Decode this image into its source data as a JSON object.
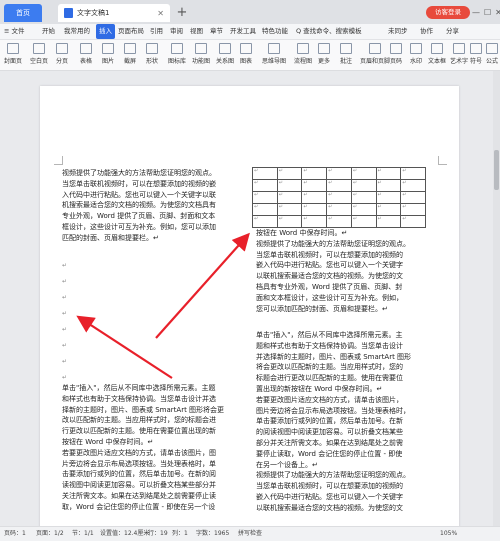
{
  "titlebar": {
    "home_tab": "首页",
    "doc_tab": "文字文稿1",
    "new_tab": "+",
    "login": "访客登录",
    "window_controls": [
      "—",
      "☐",
      "✕"
    ]
  },
  "menubar": {
    "items": [
      "≡ 文件",
      "开始",
      "插入",
      "页面布局",
      "引用",
      "审阅",
      "视图",
      "章节",
      "开发工具",
      "特色功能",
      "Q 查找命令、搜索模板"
    ],
    "active": "插入",
    "right": [
      "未同步",
      "协作",
      "分享"
    ]
  },
  "ribbon": {
    "items": [
      "封面页",
      "空白页",
      "分页",
      "表格",
      "图片",
      "截屏",
      "形状",
      "图标库",
      "功能图",
      "关系图",
      "图表",
      "思维导图",
      "流程图",
      "更多",
      "批注",
      "页眉和页脚",
      "页码",
      "水印",
      "文本框",
      "艺术字",
      "符号",
      "公式"
    ]
  },
  "document": {
    "left_col": [
      "视频提供了功能强大的方法帮助您证明您的观点。",
      "当您单击联机视频时，可以在想要添加的视频的嵌",
      "入代码中进行粘贴。您也可以键入一个关键字以联",
      "机搜索最适合您的文档的视频。为使您的文档具有",
      "专业外观，Word 提供了页眉、页脚、封面和文本",
      "框设计，这些设计可互为补充。例如，您可以添加",
      "匹配的封面、页眉和提要栏。↵"
    ],
    "left_col_bottom": [
      "单击\"插入\"，然后从不同库中选择所需元素。主题",
      "和样式也有助于文档保持协调。当您单击设计并选",
      "择新的主题时，图片、图表或 SmartArt 图形将会更",
      "改以匹配新的主题。当应用样式时，您的标题会进",
      "行更改以匹配新的主题。使用在需要位置出现的新",
      "按钮在 Word 中保存时间。↵",
      "若要更改图片适应文档的方式，请单击该图片，图",
      "片旁边将会显示布局选项按钮。当处理表格时，单",
      "击要添加行或列的位置，然后单击加号。在新的阅",
      "读视图中阅读更加容易。可以折叠文档某些部分并",
      "关注所需文本。如果在达到结尾处之前需要停止读",
      "取，Word 会记住您的停止位置 - 即使在另一个设"
    ],
    "right_col_top": [
      "按钮在 Word 中保存时间。↵",
      "视频提供了功能强大的方法帮助您证明您的观点。",
      "当您单击联机视频时，可以在想要添加的视频的",
      "嵌入代码中进行粘贴。您也可以键入一个关键字",
      "以联机搜索最适合您的文档的视频。为使您的文",
      "档具有专业外观，Word 提供了页眉、页脚、封",
      "面和文本框设计，这些设计可互为补充。例如，",
      "您可以添加匹配的封面、页眉和提要栏。↵"
    ],
    "right_col_bottom": [
      "单击\"插入\"，然后从不同库中选择所需元素。主",
      "题和样式也有助于文档保持协调。当您单击设计",
      "并选择新的主题时，图片、图表或 SmartArt 图形",
      "将会更改以匹配新的主题。当应用样式时，您的",
      "标题会进行更改以匹配新的主题。使用在需要位",
      "置出现的新按钮在 Word 中保存时间。↵",
      "若要更改图片适应文档的方式，请单击该图片，",
      "图片旁边将会显示布局选项按钮。当处理表格时，",
      "单击要添加行或列的位置，然后单击加号。在新",
      "的阅读视图中阅读更加容易。可以折叠文档某些",
      "部分并关注所需文本。如果在达到结尾处之前需",
      "要停止读取，Word 会记住您的停止位置 - 即使",
      "在另一个设备上。↵",
      "视频提供了功能强大的方法帮助您证明您的观点。",
      "当您单击联机视频时，可以在想要添加的视频的",
      "嵌入代码中进行粘贴。您也可以键入一个关键字",
      "以联机搜索最适合您的文档的视频。为使您的文"
    ],
    "para_mark": "↵",
    "table_cell_mark": "↵"
  },
  "status": {
    "page": "页码：1",
    "pages": "页面：1/2",
    "section": "节：1/1",
    "setting": "设置值：12.4厘米",
    "row": "行：19",
    "col": "列：1",
    "words": "字数：1965",
    "spell": "拼写检查",
    "zoom": "105%"
  },
  "colors": {
    "accent": "#2f6be4",
    "login": "#e84a3c",
    "arrow": "#e8202a"
  }
}
